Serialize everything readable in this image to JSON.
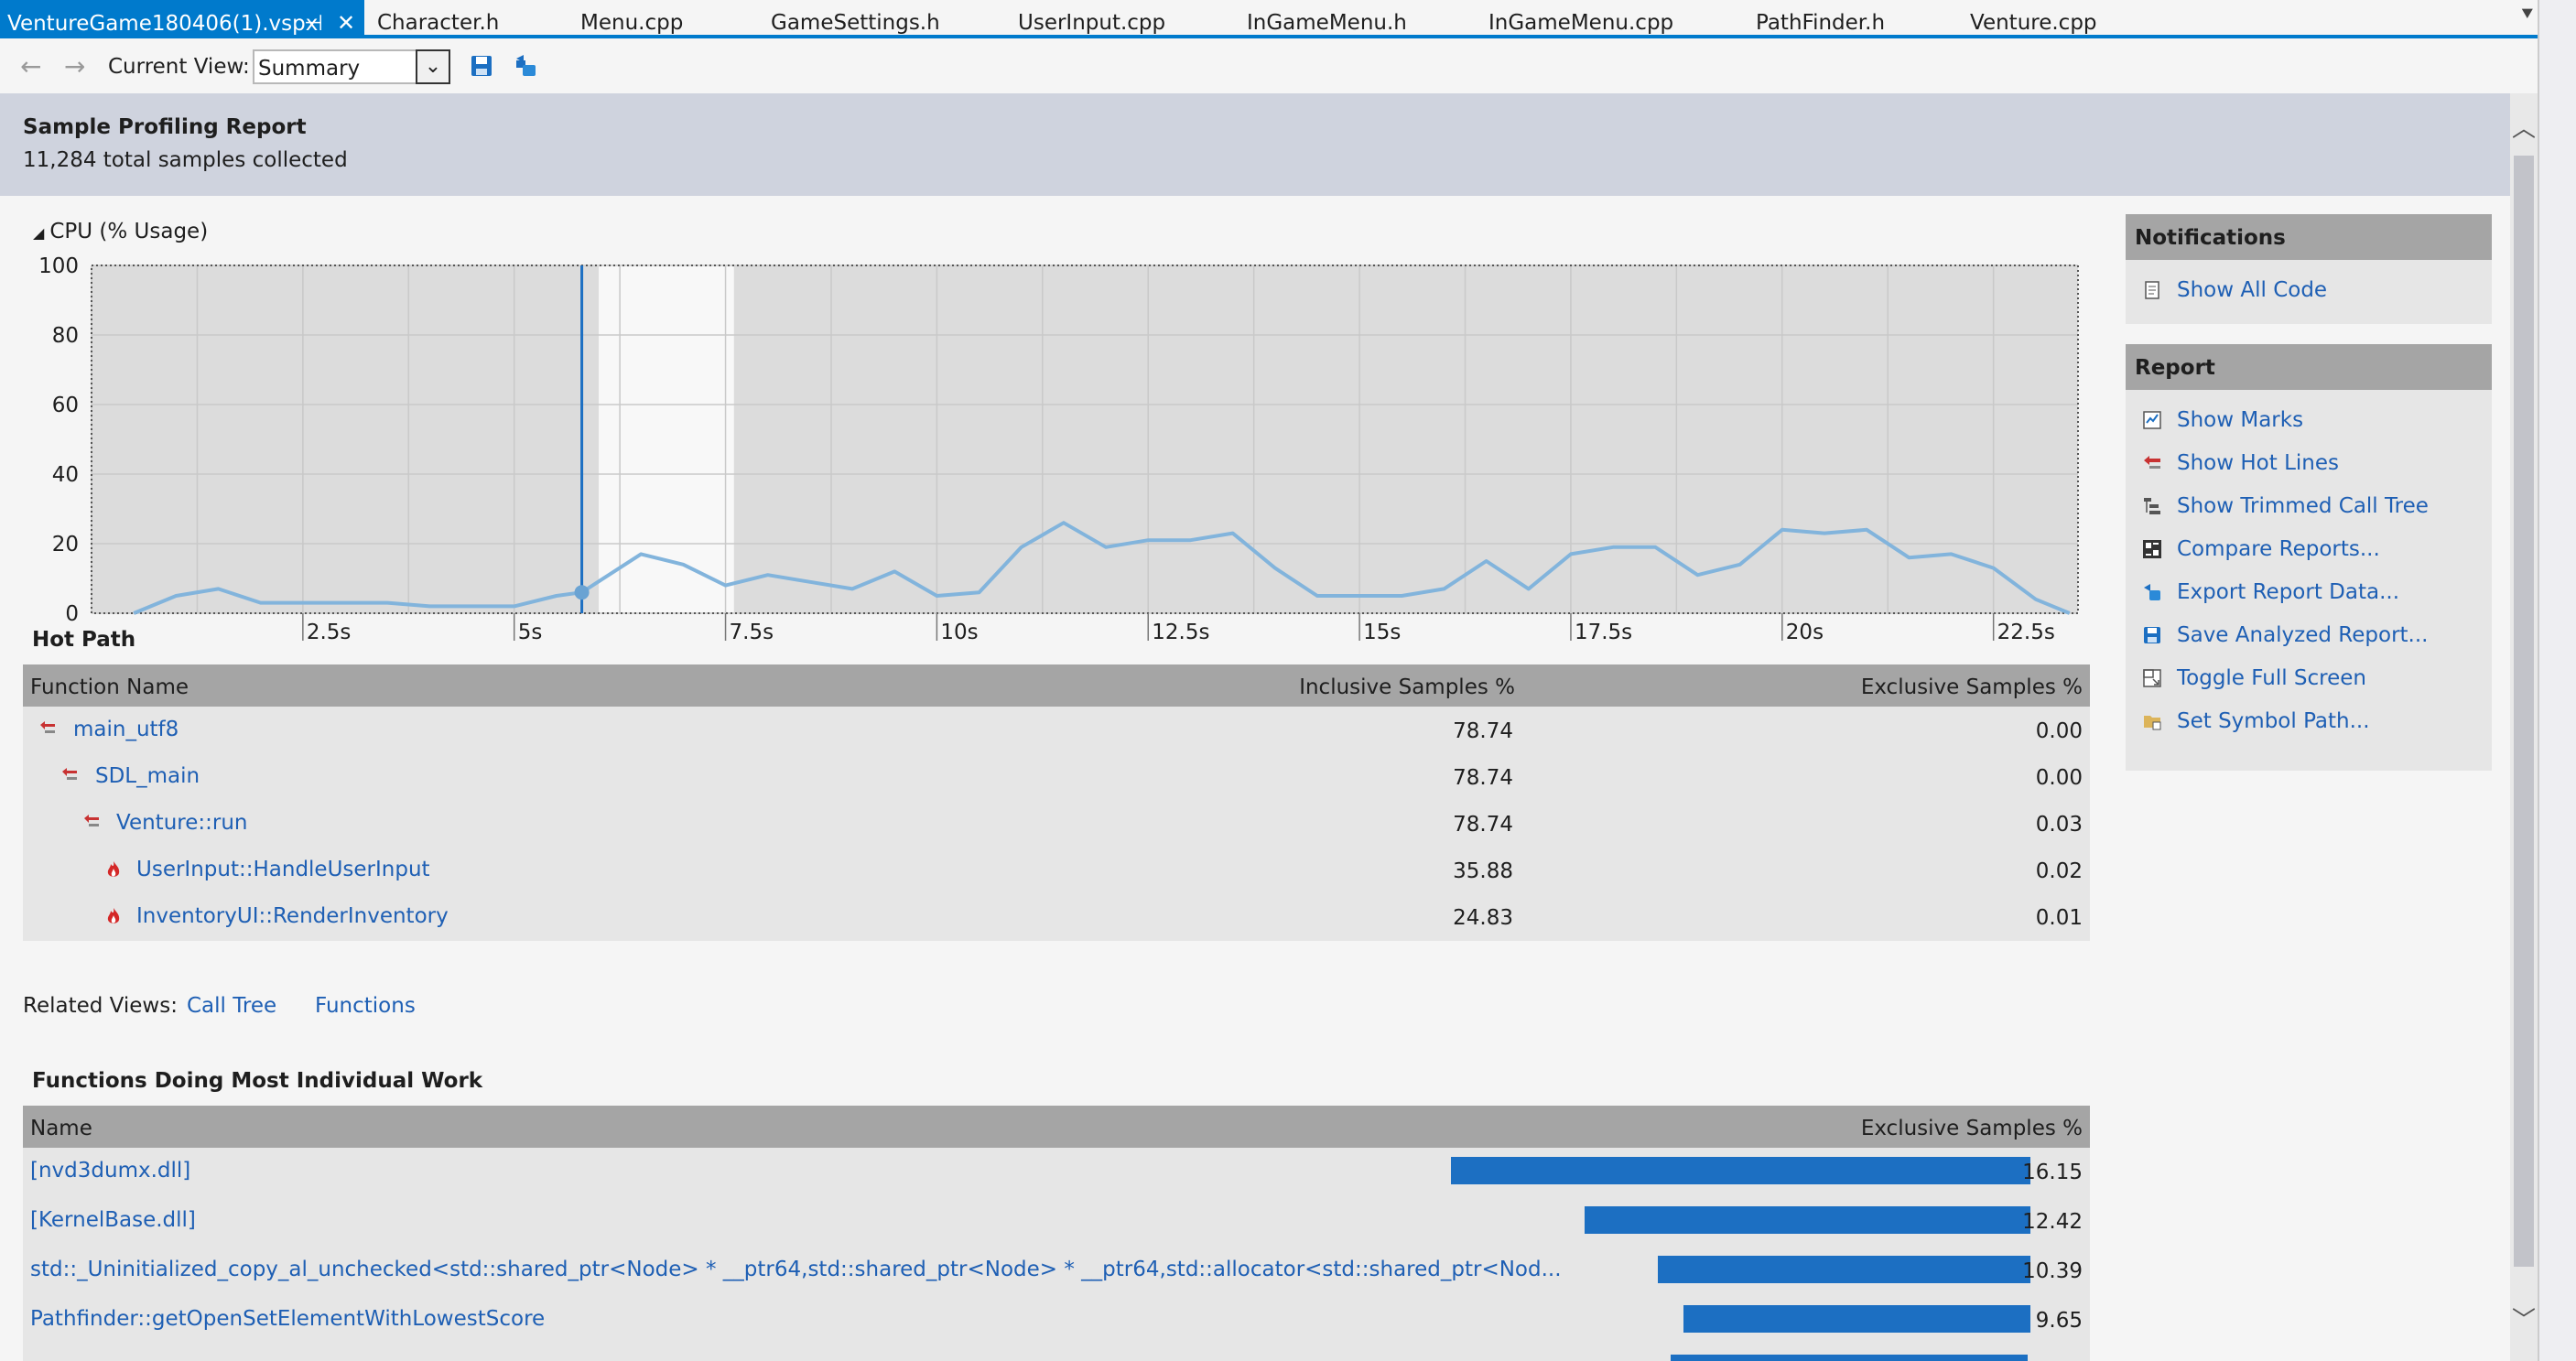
{
  "tabs": [
    {
      "label": "VentureGame180406(1).vspx",
      "active": true
    },
    {
      "label": "Character.h"
    },
    {
      "label": "Menu.cpp"
    },
    {
      "label": "GameSettings.h"
    },
    {
      "label": "UserInput.cpp"
    },
    {
      "label": "InGameMenu.h"
    },
    {
      "label": "InGameMenu.cpp"
    },
    {
      "label": "PathFinder.h"
    },
    {
      "label": "Venture.cpp"
    }
  ],
  "toolbar": {
    "back_icon": "back-arrow-icon",
    "forward_icon": "forward-arrow-icon",
    "current_view_label": "Current View:",
    "current_view_value": "Summary",
    "save_icon": "save-icon",
    "export_icon": "export-icon"
  },
  "header": {
    "title": "Sample Profiling Report",
    "subtitle": "11,284 total samples collected"
  },
  "chart_data": {
    "type": "area",
    "title": "CPU (% Usage)",
    "xlabel": "",
    "ylabel": "",
    "xlim": [
      0,
      23.5
    ],
    "ylim": [
      0,
      100
    ],
    "y_ticks": [
      "100",
      "80",
      "60",
      "40",
      "20",
      "0"
    ],
    "x_ticks": [
      "2.5s",
      "5s",
      "7.5s",
      "10s",
      "12.5s",
      "15s",
      "17.5s",
      "20s",
      "22.5s"
    ],
    "grid": true,
    "selection": {
      "start": 6.0,
      "end": 7.6
    },
    "marker": {
      "x": 5.8,
      "y": 6
    },
    "series": [
      {
        "x": [
          0.5,
          1.0,
          1.5,
          2.0,
          2.5,
          3.0,
          3.5,
          4.0,
          4.5,
          5.0,
          5.5,
          5.8,
          6.5,
          7.0,
          7.5,
          8.0,
          8.5,
          9.0,
          9.5,
          10.0,
          10.5,
          11.0,
          11.5,
          12.0,
          12.5,
          13.0,
          13.5,
          14.0,
          14.5,
          15.0,
          15.5,
          16.0,
          16.5,
          17.0,
          17.5,
          18.0,
          18.5,
          19.0,
          19.5,
          20.0,
          20.5,
          21.0,
          21.5,
          22.0,
          22.5,
          23.0,
          23.4
        ],
        "values": [
          0,
          5,
          7,
          3,
          3,
          3,
          3,
          2,
          2,
          2,
          5,
          6,
          17,
          14,
          8,
          11,
          9,
          7,
          12,
          5,
          6,
          19,
          26,
          19,
          21,
          21,
          23,
          13,
          5,
          5,
          5,
          7,
          15,
          7,
          17,
          19,
          19,
          11,
          14,
          24,
          23,
          24,
          16,
          17,
          13,
          4,
          0
        ]
      }
    ]
  },
  "hot_path": {
    "title": "Hot Path",
    "columns": [
      "Function Name",
      "Inclusive Samples %",
      "Exclusive Samples %"
    ],
    "rows": [
      {
        "name": "main_utf8",
        "inclusive": "78.74",
        "exclusive": "0.00",
        "icon": "hot-path-arrow-icon"
      },
      {
        "name": "SDL_main",
        "inclusive": "78.74",
        "exclusive": "0.00",
        "icon": "hot-path-arrow-icon"
      },
      {
        "name": "Venture::run",
        "inclusive": "78.74",
        "exclusive": "0.03",
        "icon": "hot-path-arrow-icon"
      },
      {
        "name": "UserInput::HandleUserInput",
        "inclusive": "35.88",
        "exclusive": "0.02",
        "icon": "flame-icon"
      },
      {
        "name": "InventoryUI::RenderInventory",
        "inclusive": "24.83",
        "exclusive": "0.01",
        "icon": "flame-icon"
      }
    ]
  },
  "related_views": {
    "label": "Related Views:",
    "links": [
      "Call Tree",
      "Functions"
    ]
  },
  "individual_work": {
    "title": "Functions Doing Most Individual Work",
    "columns": [
      "Name",
      "Exclusive Samples %"
    ],
    "max_value": 16.15,
    "rows": [
      {
        "name": "[nvd3dumx.dll]",
        "value": "16.15",
        "fraction": 1.0
      },
      {
        "name": "[KernelBase.dll]",
        "value": "12.42",
        "fraction": 0.769
      },
      {
        "name": "std::_Uninitialized_copy_al_unchecked<std::shared_ptr<Node> * __ptr64,std::shared_ptr<Node> * __ptr64,std::allocator<std::shared_ptr<Nod...",
        "value": "10.39",
        "fraction": 0.643
      },
      {
        "name": "Pathfinder::getOpenSetElementWithLowestScore",
        "value": "9.65",
        "fraction": 0.598
      }
    ]
  },
  "notifications": {
    "title": "Notifications",
    "items": [
      {
        "label": "Show All Code",
        "icon": "document-icon"
      }
    ]
  },
  "report": {
    "title": "Report",
    "items": [
      {
        "label": "Show Marks",
        "icon": "marks-icon"
      },
      {
        "label": "Show Hot Lines",
        "icon": "hot-lines-icon"
      },
      {
        "label": "Show Trimmed Call Tree",
        "icon": "call-tree-icon"
      },
      {
        "label": "Compare Reports...",
        "icon": "compare-icon"
      },
      {
        "label": "Export Report Data...",
        "icon": "export-icon"
      },
      {
        "label": "Save Analyzed Report...",
        "icon": "save-icon"
      },
      {
        "label": "Toggle Full Screen",
        "icon": "fullscreen-icon"
      },
      {
        "label": "Set Symbol Path...",
        "icon": "folder-icon"
      }
    ]
  },
  "colors": {
    "accent": "#007acc",
    "link": "#1e5fb4",
    "bar": "#1c6fc2",
    "cpu_line": "#82b4dc",
    "header_band": "#cfd3de",
    "grid_header": "#a5a5a5"
  }
}
